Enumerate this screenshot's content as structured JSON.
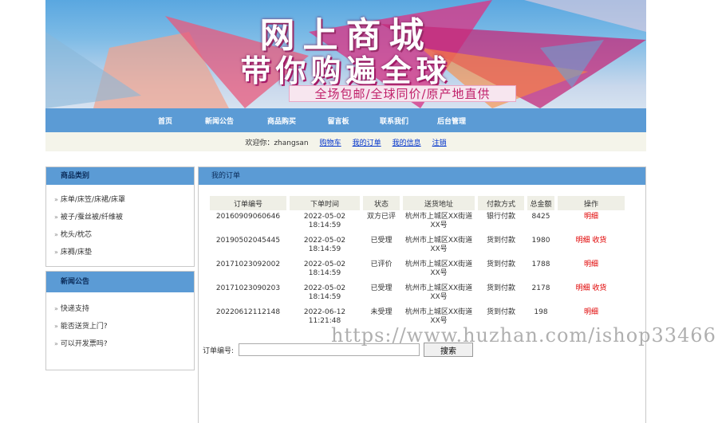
{
  "banner": {
    "title": "网上商城",
    "subtitle": "带你购遍全球",
    "slogan": "全场包邮/全球同价/原产地直供"
  },
  "nav": [
    "首页",
    "新闻公告",
    "商品购买",
    "留言板",
    "联系我们",
    "后台管理"
  ],
  "userbar": {
    "welcome": "欢迎你：zhangsan",
    "cart": "购物车",
    "orders": "我的订单",
    "info": "我的信息",
    "logout": "注销"
  },
  "category": {
    "title": "商品类别",
    "items": [
      "床单/床笠/床裙/床罩",
      "被子/蚕丝被/纤维被",
      "枕头/枕芯",
      "床褥/床垫"
    ]
  },
  "news": {
    "title": "新闻公告",
    "items": [
      "快递支持",
      "能否送货上门?",
      "可以开发票吗?"
    ]
  },
  "main": {
    "title": "我的订单",
    "columns": [
      "订单编号",
      "下单时间",
      "状态",
      "送货地址",
      "付款方式",
      "总金额",
      "操作"
    ],
    "rows": [
      {
        "id": "20160909060646",
        "date": "2022-05-02",
        "time": "18:14:59",
        "status": "双方已评",
        "addr1": "杭州市上城区XX街道",
        "addr2": "XX号",
        "pay": "银行付款",
        "total": "8425",
        "ops": "明细"
      },
      {
        "id": "20190502045445",
        "date": "2022-05-02",
        "time": "18:14:59",
        "status": "已受理",
        "addr1": "杭州市上城区XX街道",
        "addr2": "XX号",
        "pay": "货到付款",
        "total": "1980",
        "ops": "明细 收货"
      },
      {
        "id": "20171023092002",
        "date": "2022-05-02",
        "time": "18:14:59",
        "status": "已评价",
        "addr1": "杭州市上城区XX街道",
        "addr2": "XX号",
        "pay": "货到付款",
        "total": "1788",
        "ops": "明细"
      },
      {
        "id": "20171023090203",
        "date": "2022-05-02",
        "time": "18:14:59",
        "status": "已受理",
        "addr1": "杭州市上城区XX街道",
        "addr2": "XX号",
        "pay": "货到付款",
        "total": "2178",
        "ops": "明细 收货"
      },
      {
        "id": "20220612112148",
        "date": "2022-06-12",
        "time": "11:21:48",
        "status": "未受理",
        "addr1": "杭州市上城区XX街道",
        "addr2": "XX号",
        "pay": "货到付款",
        "total": "198",
        "ops": "明细"
      }
    ],
    "search_label": "订单编号:",
    "search_value": "",
    "search_button": "搜索"
  },
  "watermark": "https://www.huzhan.com/ishop33466",
  "colors": {
    "nav": "#5b9bd5",
    "accent": "#e00000",
    "link": "#0033cc"
  }
}
